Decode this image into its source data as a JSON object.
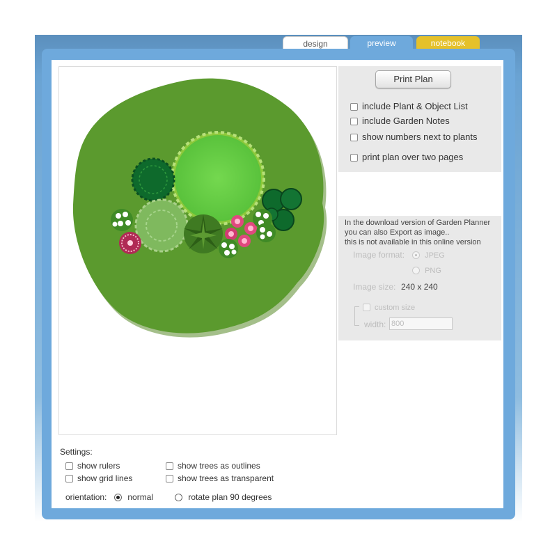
{
  "tabs": [
    {
      "label": "design"
    },
    {
      "label": "preview"
    },
    {
      "label": "notebook"
    }
  ],
  "print": {
    "button_label": "Print Plan",
    "options": [
      {
        "label": "include Plant & Object List",
        "checked": false
      },
      {
        "label": "include Garden Notes",
        "checked": false
      },
      {
        "label": "show numbers next to plants",
        "checked": false
      },
      {
        "label": "print plan over two pages",
        "checked": false
      }
    ]
  },
  "export": {
    "note_line1": "In the download version of Garden Planner",
    "note_line2": "you can also Export as image..",
    "note_line3": "this is not available in this online version",
    "format_label": "Image format:",
    "format_options": [
      "JPEG",
      "PNG"
    ],
    "format_selected": "JPEG",
    "size_label": "Image size:",
    "size_value": "240 x 240",
    "custom_size_label": "custom size",
    "width_label": "width:",
    "width_value": "800"
  },
  "settings": {
    "title": "Settings:",
    "show_rulers": "show rulers",
    "show_grid_lines": "show grid lines",
    "trees_outlines": "show trees as outlines",
    "trees_transparent": "show trees as transparent",
    "orientation_label": "orientation:",
    "orientation_normal": "normal",
    "orientation_rotate": "rotate plan 90 degrees",
    "orientation_selected": "normal"
  },
  "colors": {
    "frame_blue": "#6ea9dc",
    "notebook_yellow": "#e5c12a",
    "lawn_green": "#5b9a2e",
    "shrub_light_green": "#6fd04b",
    "shrub_dark_green": "#0e6a2c",
    "flower_pink": "#d94f83"
  }
}
